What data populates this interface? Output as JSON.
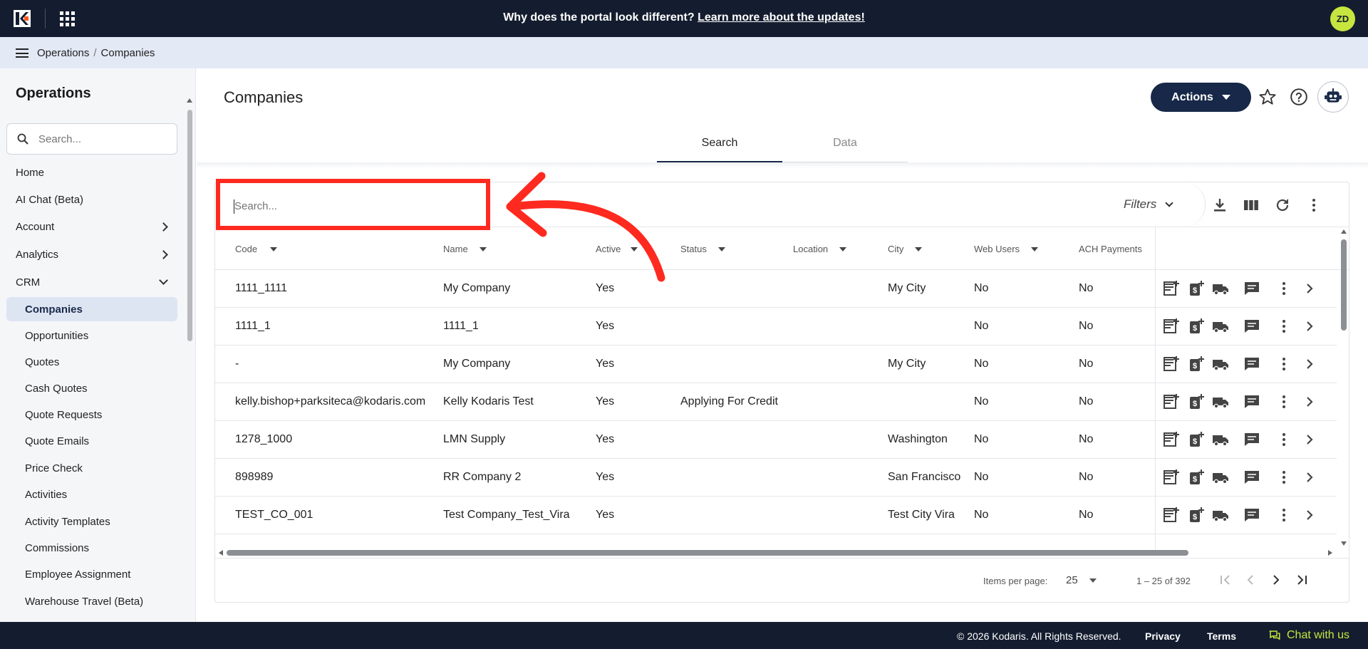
{
  "topbar": {
    "banner_text": "Why does the portal look different?",
    "banner_link": "Learn more about the updates!",
    "avatar_initials": "ZD"
  },
  "breadcrumb": {
    "items": [
      "Operations",
      "Companies"
    ],
    "separator": "/"
  },
  "sidebar": {
    "title": "Operations",
    "search_placeholder": "Search...",
    "top_items": [
      {
        "label": "Home"
      },
      {
        "label": "AI Chat (Beta)"
      },
      {
        "label": "Account",
        "expandable": true
      },
      {
        "label": "Analytics",
        "expandable": true
      },
      {
        "label": "CRM",
        "expanded": true
      }
    ],
    "crm_items": [
      {
        "label": "Companies",
        "active": true
      },
      {
        "label": "Opportunities"
      },
      {
        "label": "Quotes"
      },
      {
        "label": "Cash Quotes"
      },
      {
        "label": "Quote Requests"
      },
      {
        "label": "Quote Emails"
      },
      {
        "label": "Price Check"
      },
      {
        "label": "Activities"
      },
      {
        "label": "Activity Templates"
      },
      {
        "label": "Commissions"
      },
      {
        "label": "Employee Assignment"
      },
      {
        "label": "Warehouse Travel (Beta)"
      }
    ]
  },
  "main": {
    "page_title": "Companies",
    "actions_label": "Actions",
    "tabs": [
      {
        "label": "Search",
        "active": true
      },
      {
        "label": "Data"
      }
    ]
  },
  "table": {
    "search_placeholder": "Search...",
    "filters_label": "Filters",
    "columns": [
      "Code",
      "Name",
      "Active",
      "Status",
      "Location",
      "City",
      "Web Users",
      "ACH Payments"
    ],
    "rows": [
      {
        "code": "1111_1111",
        "name": "My Company",
        "active": "Yes",
        "status": "",
        "location": "",
        "city": "My City",
        "web_users": "No",
        "ach": "No"
      },
      {
        "code": "1111_1",
        "name": "1111_1",
        "active": "Yes",
        "status": "",
        "location": "",
        "city": "",
        "web_users": "No",
        "ach": "No"
      },
      {
        "code": "-",
        "name": "My Company",
        "active": "Yes",
        "status": "",
        "location": "",
        "city": "My City",
        "web_users": "No",
        "ach": "No"
      },
      {
        "code": "kelly.bishop+parksiteca@kodaris.com",
        "name": "Kelly Kodaris Test",
        "active": "Yes",
        "status": "Applying For Credit",
        "location": "",
        "city": "",
        "web_users": "No",
        "ach": "No"
      },
      {
        "code": "1278_1000",
        "name": "LMN Supply",
        "active": "Yes",
        "status": "",
        "location": "",
        "city": "Washington",
        "web_users": "No",
        "ach": "No"
      },
      {
        "code": "898989",
        "name": "RR Company 2",
        "active": "Yes",
        "status": "",
        "location": "",
        "city": "San Francisco",
        "web_users": "No",
        "ach": "No"
      },
      {
        "code": "TEST_CO_001",
        "name": "Test Company_Test_Vira",
        "active": "Yes",
        "status": "",
        "location": "",
        "city": "Test City Vira",
        "web_users": "No",
        "ach": "No"
      }
    ],
    "row_actions": [
      "add-note-icon",
      "price-icon",
      "shipping-icon",
      "comment-icon",
      "more-vert-icon",
      "chevron-right-icon"
    ]
  },
  "paginator": {
    "items_per_page_label": "Items per page:",
    "items_per_page": "25",
    "range": "1 – 25 of 392"
  },
  "footer": {
    "copyright": "© 2026 Kodaris. All Rights Reserved.",
    "privacy": "Privacy",
    "terms": "Terms",
    "chat": "Chat with us"
  },
  "colors": {
    "topbar": "#141d2f",
    "accent": "#172848",
    "avatar": "#c6e63f",
    "annotation": "#ff2a1f"
  }
}
